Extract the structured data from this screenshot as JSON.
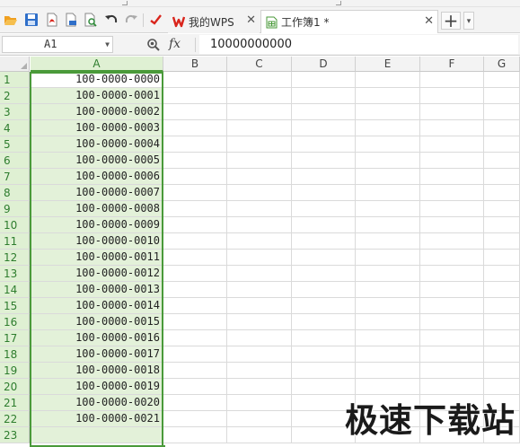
{
  "tabs": [
    {
      "label": "我的WPS",
      "active": false
    },
    {
      "label": "工作簿1 *",
      "active": true
    }
  ],
  "new_tab_symbol": "+",
  "formula_bar": {
    "name_box": "A1",
    "fx_label": "fx",
    "value": "10000000000"
  },
  "columns": [
    "A",
    "B",
    "C",
    "D",
    "E",
    "F",
    "G"
  ],
  "selected_column": "A",
  "rows": [
    {
      "num": "1",
      "a": "100-0000-0000"
    },
    {
      "num": "2",
      "a": "100-0000-0001"
    },
    {
      "num": "3",
      "a": "100-0000-0002"
    },
    {
      "num": "4",
      "a": "100-0000-0003"
    },
    {
      "num": "5",
      "a": "100-0000-0004"
    },
    {
      "num": "6",
      "a": "100-0000-0005"
    },
    {
      "num": "7",
      "a": "100-0000-0006"
    },
    {
      "num": "8",
      "a": "100-0000-0007"
    },
    {
      "num": "9",
      "a": "100-0000-0008"
    },
    {
      "num": "10",
      "a": "100-0000-0009"
    },
    {
      "num": "11",
      "a": "100-0000-0010"
    },
    {
      "num": "12",
      "a": "100-0000-0011"
    },
    {
      "num": "13",
      "a": "100-0000-0012"
    },
    {
      "num": "14",
      "a": "100-0000-0013"
    },
    {
      "num": "15",
      "a": "100-0000-0014"
    },
    {
      "num": "16",
      "a": "100-0000-0015"
    },
    {
      "num": "17",
      "a": "100-0000-0016"
    },
    {
      "num": "18",
      "a": "100-0000-0017"
    },
    {
      "num": "19",
      "a": "100-0000-0018"
    },
    {
      "num": "20",
      "a": "100-0000-0019"
    },
    {
      "num": "21",
      "a": "100-0000-0020"
    },
    {
      "num": "22",
      "a": "100-0000-0021"
    },
    {
      "num": "23",
      "a": ""
    }
  ],
  "watermark": "极速下载站",
  "icons": {
    "open": "folder-open-icon",
    "save": "save-icon",
    "pdf": "export-pdf-icon",
    "print": "print-icon",
    "preview": "print-preview-icon",
    "undo": "undo-icon",
    "redo": "redo-icon",
    "format_painter": "format-painter-icon"
  },
  "colors": {
    "selection_green": "#4a9a3a",
    "selection_fill": "#e3f1d9",
    "wps_red": "#d9251c",
    "toolbar_blue": "#2f6fc9",
    "toolbar_orange": "#f0a020"
  }
}
